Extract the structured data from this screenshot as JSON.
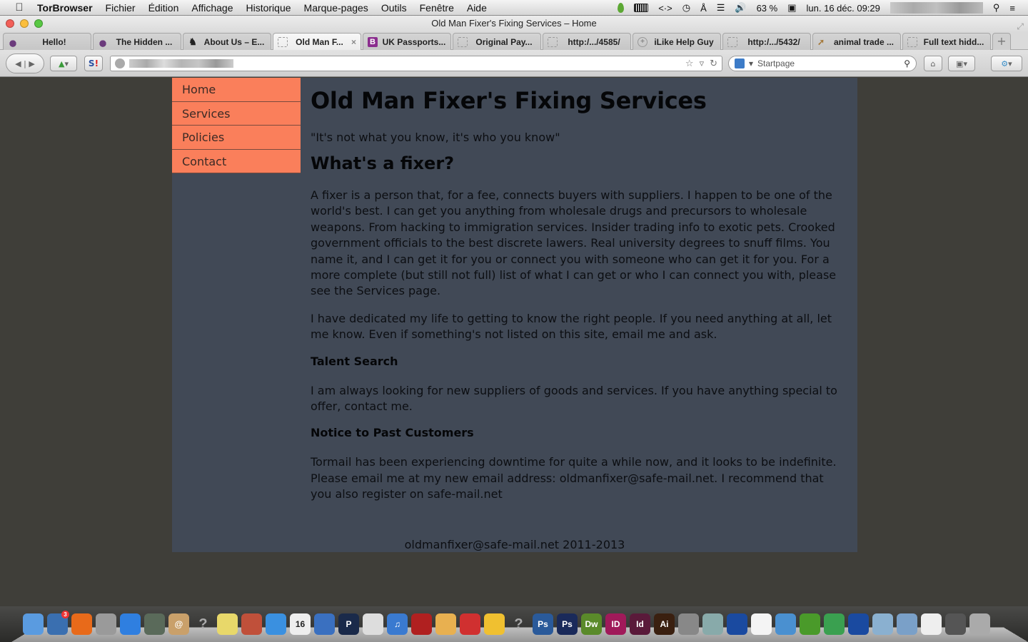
{
  "menubar": {
    "apple_icon": "apple-logo-icon",
    "app_name": "TorBrowser",
    "menus": [
      "Fichier",
      "Édition",
      "Affichage",
      "Historique",
      "Marque-pages",
      "Outils",
      "Fenêtre",
      "Aide"
    ],
    "status": {
      "battery_percent": "63 %",
      "datetime": "lun. 16 déc. 09:29"
    }
  },
  "window": {
    "title": "Old Man Fixer's Fixing Services – Home"
  },
  "tabs": [
    {
      "label": "Hello!",
      "icon": "onion"
    },
    {
      "label": "The Hidden ...",
      "icon": "onion"
    },
    {
      "label": "About Us – E...",
      "icon": "knight"
    },
    {
      "label": "Old Man F...",
      "icon": "blank",
      "active": true
    },
    {
      "label": "UK Passports...",
      "icon": "bitcoin"
    },
    {
      "label": "Original Pay...",
      "icon": "blank"
    },
    {
      "label": "http:/.../4585/",
      "icon": "blank"
    },
    {
      "label": "iLike Help Guy",
      "icon": "plus-circle"
    },
    {
      "label": "http:/.../5432/",
      "icon": "blank"
    },
    {
      "label": "animal trade ...",
      "icon": "wand"
    },
    {
      "label": "Full text hidd...",
      "icon": "blank"
    }
  ],
  "tab_close_glyph": "×",
  "new_tab_glyph": "+",
  "navbar": {
    "search_engine": "Startpage",
    "search_placeholder": "Startpage",
    "url": ""
  },
  "page": {
    "nav": [
      "Home",
      "Services",
      "Policies",
      "Contact"
    ],
    "title": "Old Man Fixer's Fixing Services",
    "tagline": "\"It's not what you know, it's who you know\"",
    "section_heading": "What's a fixer?",
    "paragraph1": "A fixer is a person that, for a fee, connects buyers with suppliers. I happen to be one of the world's best. I can get you anything from wholesale drugs and precursors to wholesale weapons. From hacking to immigration services. Insider trading info to exotic pets. Crooked government officials to the best discrete lawers. Real university degrees to snuff films. You name it, and I can get it for you or connect you with someone who can get it for you. For a more complete (but still not full) list of what I can get or who I can connect you with, please see the Services page.",
    "paragraph2": "I have dedicated my life to getting to know the right people. If you need anything at all, let me know. Even if something's not listed on this site, email me and ask.",
    "talent_heading": "Talent Search",
    "talent_text": "I am always looking for new suppliers of goods and services. If you have anything special to offer, contact me.",
    "notice_heading": "Notice to Past Customers",
    "notice_text": "Tormail has been experiencing downtime for quite a while now, and it looks to be indefinite. Please email me at my new email address: oldmanfixer@safe-mail.net. I recommend that you also register on safe-mail.net",
    "footer": "oldmanfixer@safe-mail.net 2011-2013"
  },
  "colors": {
    "nav_bg": "#fa7f5b",
    "content_bg": "#414956",
    "page_bg": "#3f3e39"
  },
  "dock": {
    "items": [
      {
        "name": "finder",
        "label": ""
      },
      {
        "name": "thunderbird",
        "label": "",
        "badge": "3"
      },
      {
        "name": "firefox",
        "label": ""
      },
      {
        "name": "launchpad",
        "label": ""
      },
      {
        "name": "app-store",
        "label": ""
      },
      {
        "name": "image-capture",
        "label": ""
      },
      {
        "name": "address-book",
        "label": "@"
      },
      {
        "name": "unknown-app",
        "label": "?"
      },
      {
        "name": "stickies",
        "label": ""
      },
      {
        "name": "keynote",
        "label": ""
      },
      {
        "name": "dropbox",
        "label": ""
      },
      {
        "name": "calendar",
        "label": "16"
      },
      {
        "name": "numbers",
        "label": ""
      },
      {
        "name": "plex",
        "label": "P"
      },
      {
        "name": "printer",
        "label": ""
      },
      {
        "name": "itunes",
        "label": "♫"
      },
      {
        "name": "photo-booth",
        "label": ""
      },
      {
        "name": "pages",
        "label": ""
      },
      {
        "name": "tomato-timer",
        "label": ""
      },
      {
        "name": "cyberduck",
        "label": ""
      },
      {
        "name": "unknown-app-2",
        "label": "?"
      },
      {
        "name": "photoshop",
        "label": "Ps"
      },
      {
        "name": "photoshop-2",
        "label": "Ps"
      },
      {
        "name": "dreamweaver",
        "label": "Dw"
      },
      {
        "name": "indesign",
        "label": "ID"
      },
      {
        "name": "incopy",
        "label": "Id"
      },
      {
        "name": "illustrator",
        "label": "Ai"
      },
      {
        "name": "automator",
        "label": ""
      },
      {
        "name": "iphoto",
        "label": ""
      },
      {
        "name": "vuze",
        "label": ""
      },
      {
        "name": "document",
        "label": ""
      },
      {
        "name": "safari",
        "label": ""
      },
      {
        "name": "tor-onion",
        "label": ""
      },
      {
        "name": "network-globe",
        "label": ""
      },
      {
        "name": "vuze-2",
        "label": ""
      },
      {
        "name": "folder",
        "label": ""
      },
      {
        "name": "folder-windows",
        "label": ""
      },
      {
        "name": "screenshot-doc",
        "label": ""
      },
      {
        "name": "illustrator-file",
        "label": ""
      },
      {
        "name": "trash",
        "label": ""
      }
    ]
  }
}
